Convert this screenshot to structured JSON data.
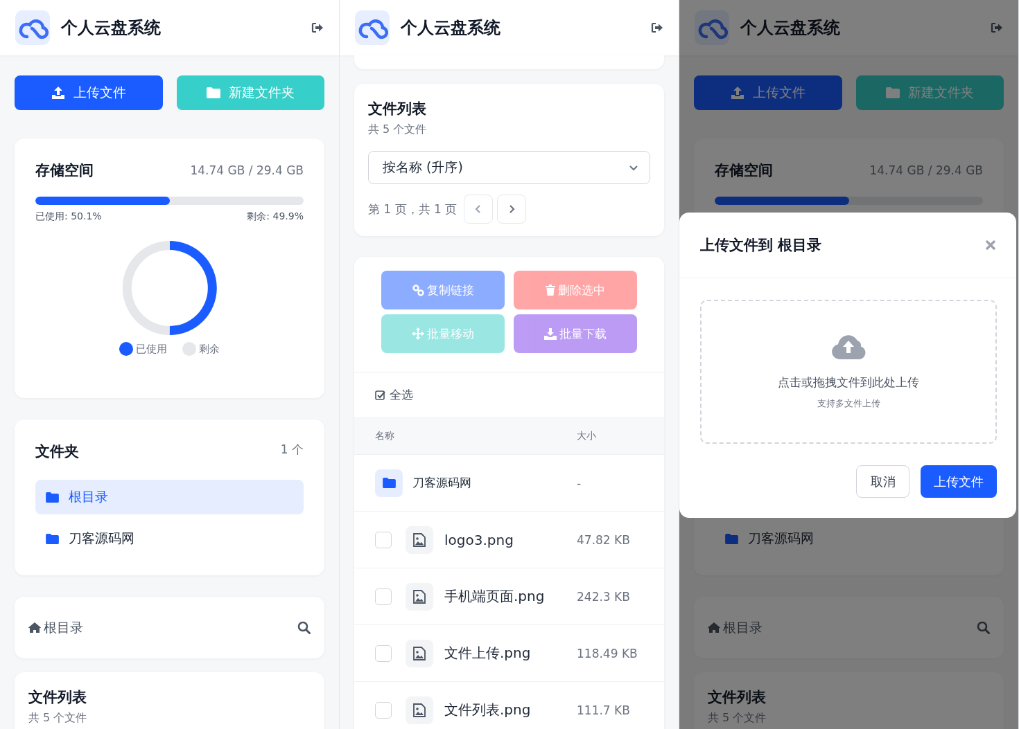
{
  "screens": [
    {
      "header": {
        "title": "个人云盘系统"
      },
      "sections": [
        {
          "kind": "actions",
          "buttons": [
            {
              "label": "上传文件",
              "kind": "upload"
            },
            {
              "label": "新建文件夹",
              "kind": "folder"
            }
          ]
        },
        {
          "kind": "storage",
          "title": "存储空间",
          "usage": "14.74 GB / 29.4 GB",
          "level": 0.501,
          "used_label": "已使用: 50.1%",
          "free_label": "剩余: 49.9%",
          "chart_data": {
            "type": "donut",
            "legend": "bottom",
            "categories": [
              "已使用",
              "剩余"
            ],
            "values": [
              50.1,
              49.9
            ]
          }
        },
        {
          "kind": "folders",
          "title": "文件夹",
          "count": "1 个",
          "items": [
            {
              "label": "根目录",
              "selected": true
            },
            {
              "label": "刀客源码网",
              "selected": false
            }
          ]
        },
        {
          "kind": "breadcrumb",
          "label": "根目录"
        },
        {
          "kind": "list_header",
          "title": "文件列表",
          "subtitle": "共 5 个文件"
        }
      ]
    },
    {
      "header": {
        "title": "个人云盘系统"
      },
      "sections": [
        {
          "kind": "card_end"
        },
        {
          "kind": "list_header",
          "title": "文件列表",
          "subtitle": "共 5 个文件",
          "sort": "按名称 (升序)",
          "page": "第 1 页，共 1 页"
        },
        {
          "kind": "files",
          "actions": [
            {
              "label": "复制链接",
              "kind": "link",
              "disabled": true
            },
            {
              "label": "删除选中",
              "kind": "delete",
              "disabled": true
            },
            {
              "label": "批量移动",
              "kind": "move",
              "disabled": true
            },
            {
              "label": "批量下载",
              "kind": "download",
              "disabled": true
            }
          ],
          "select_all": "全选",
          "columns": [
            "名称",
            "大小"
          ],
          "rows": [
            {
              "kind": "folder",
              "name": "刀客源码网",
              "size": "-"
            },
            {
              "kind": "file",
              "name": "logo3.png",
              "size": "47.82 KB",
              "checked": false
            },
            {
              "kind": "file",
              "name": "手机端页面.png",
              "size": "242.3 KB",
              "checked": false
            },
            {
              "kind": "file",
              "name": "文件上传.png",
              "size": "118.49 KB",
              "checked": false
            },
            {
              "kind": "file",
              "name": "文件列表.png",
              "size": "111.7 KB",
              "checked": false
            }
          ]
        }
      ]
    },
    {
      "header": {
        "title": "个人云盘系统"
      },
      "sections": [
        {
          "kind": "actions",
          "buttons": [
            {
              "label": "上传文件",
              "kind": "upload"
            },
            {
              "label": "新建文件夹",
              "kind": "folder"
            }
          ]
        },
        {
          "kind": "storage",
          "title": "存储空间",
          "usage": "14.74 GB / 29.4 GB",
          "level": 0.501
        },
        {
          "kind": "folders",
          "items": [
            {
              "label": "刀客源码网",
              "selected": false
            }
          ]
        },
        {
          "kind": "breadcrumb",
          "label": "根目录"
        },
        {
          "kind": "list_header",
          "title": "文件列表",
          "subtitle": "共 5 个文件"
        }
      ],
      "modal": {
        "title": "上传文件到 根目录",
        "drop_text": "点击或拖拽文件到此处上传",
        "drop_hint": "支持多文件上传",
        "buttons": [
          {
            "label": "取消",
            "kind": "secondary"
          },
          {
            "label": "上传文件",
            "kind": "primary"
          }
        ]
      }
    }
  ]
}
